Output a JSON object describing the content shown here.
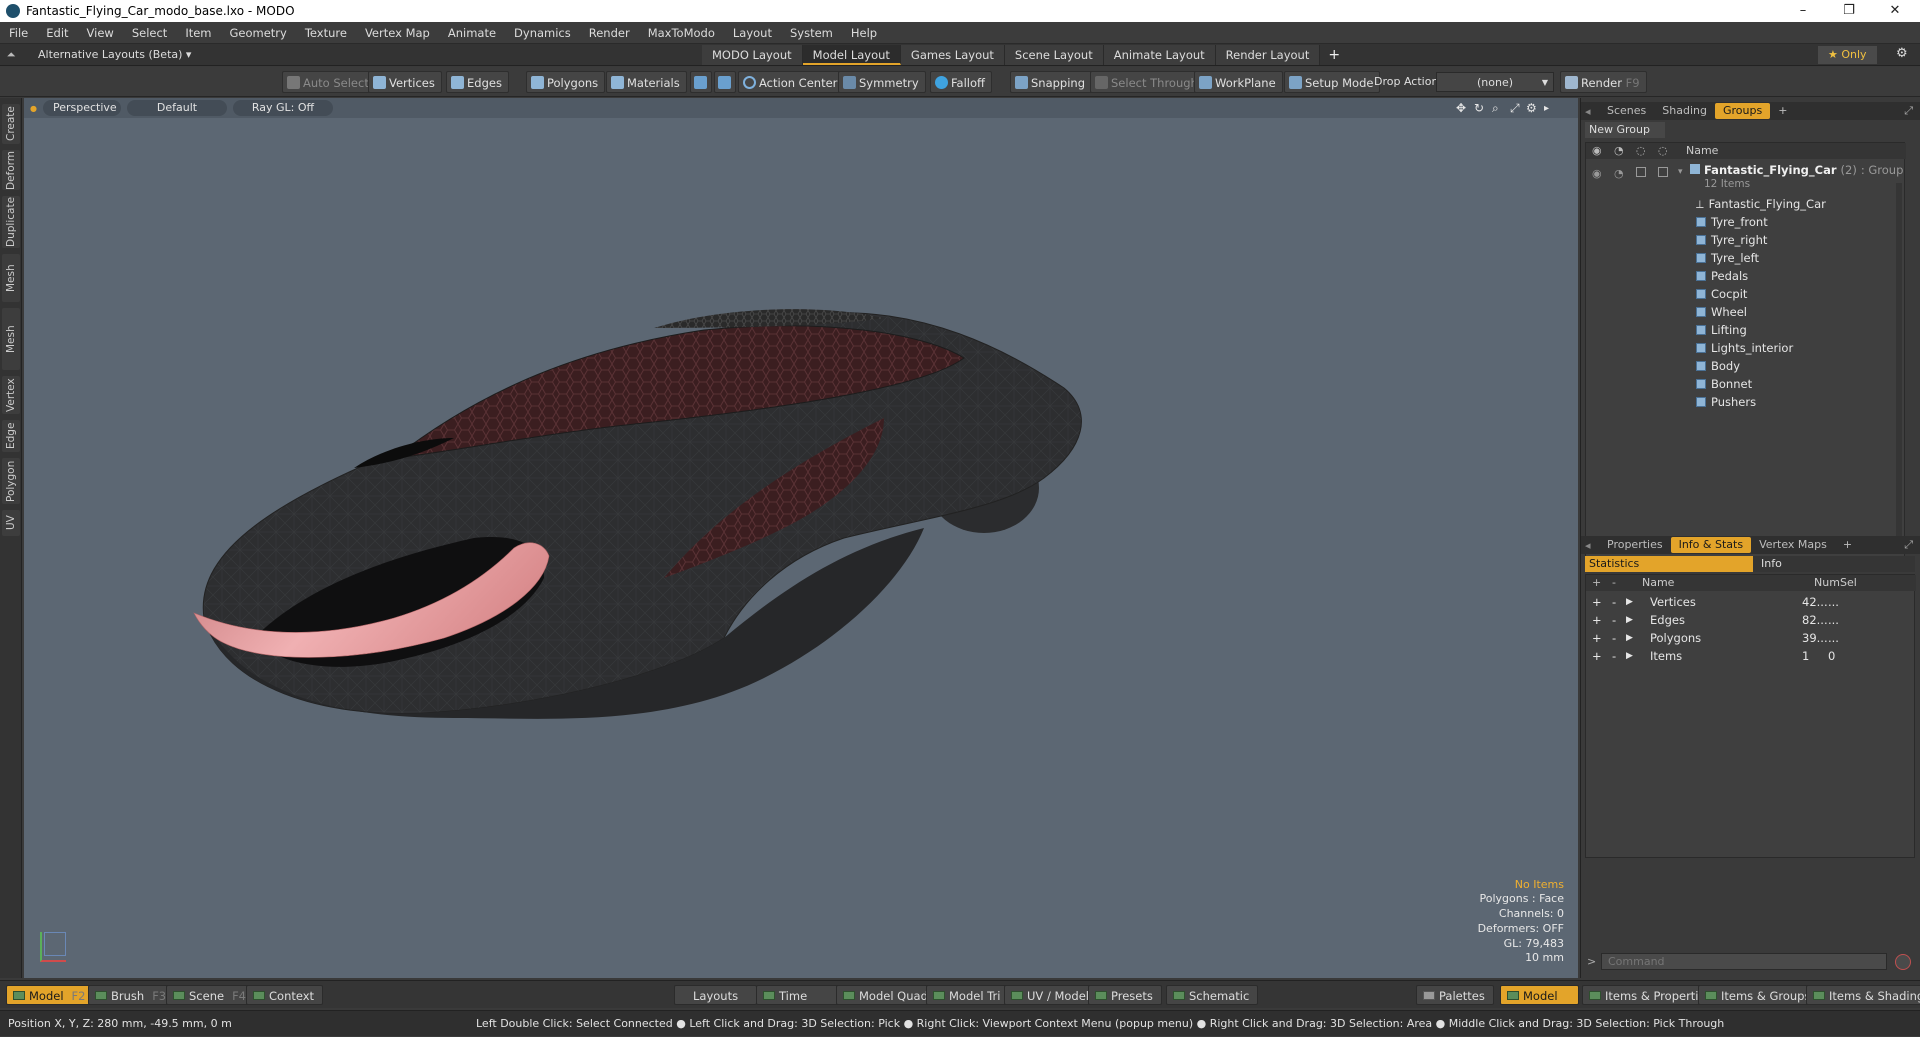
{
  "window": {
    "title": "Fantastic_Flying_Car_modo_base.lxo - MODO",
    "minimize": "–",
    "maximize": "❐",
    "close": "✕"
  },
  "menu": [
    "File",
    "Edit",
    "View",
    "Select",
    "Item",
    "Geometry",
    "Texture",
    "Vertex Map",
    "Animate",
    "Dynamics",
    "Render",
    "MaxToModo",
    "Layout",
    "System",
    "Help"
  ],
  "layouts": {
    "alt_label": "Alternative Layouts (Beta) ▾",
    "tabs": [
      "MODO Layout",
      "Model Layout",
      "Games Layout",
      "Scene Layout",
      "Animate Layout",
      "Render Layout"
    ],
    "active": "Model Layout",
    "add": "+",
    "only": "★  Only",
    "gear": "⚙"
  },
  "toolbar": {
    "auto_select": "Auto Select",
    "vertices": "Vertices",
    "edges": "Edges",
    "polygons": "Polygons",
    "materials": "Materials",
    "action_center": "Action Center",
    "symmetry": "Symmetry",
    "falloff": "Falloff",
    "snapping": "Snapping",
    "select_through": "Select Through",
    "workplane": "WorkPlane",
    "setup_mode": "Setup Mode",
    "drop_action": "Drop Action",
    "drop_value": "(none)",
    "render": "Render",
    "render_key": "F9"
  },
  "left_tabs": [
    "Create",
    "Deform",
    "Duplicate",
    "Mesh Edit",
    "Mesh Fusion",
    "Vertex",
    "Edge",
    "Polygon",
    "UV"
  ],
  "viewport": {
    "view": "Perspective",
    "shading": "Default",
    "raygl": "Ray GL: Off",
    "stats": [
      "No Items",
      "Polygons : Face",
      "Channels: 0",
      "Deformers: OFF",
      "GL: 79,483",
      "10 mm"
    ]
  },
  "scene_panel": {
    "tabs": [
      "Scenes",
      "Shading",
      "Groups"
    ],
    "active": "Groups",
    "new_group": "New Group",
    "name_header": "Name",
    "group_name": "Fantastic_Flying_Car",
    "group_count": "(2)",
    "group_type": ": Group",
    "group_items": "12 Items",
    "items": [
      "Fantastic_Flying_Car",
      "Tyre_front",
      "Tyre_right",
      "Tyre_left",
      "Pedals",
      "Cocpit",
      "Wheel",
      "Lifting",
      "Lights_interior",
      "Body",
      "Bonnet",
      "Pushers"
    ]
  },
  "info_panel": {
    "tabs": [
      "Properties",
      "Info & Stats",
      "Vertex Maps"
    ],
    "active": "Info & Stats",
    "subtabs": [
      "Statistics",
      "Info"
    ],
    "headers": {
      "name": "Name",
      "num": "Num",
      "sel": "Sel"
    },
    "rows": [
      {
        "name": "Vertices",
        "num": "42...",
        "sel": "..."
      },
      {
        "name": "Edges",
        "num": "82...",
        "sel": "..."
      },
      {
        "name": "Polygons",
        "num": "39...",
        "sel": "..."
      },
      {
        "name": "Items",
        "num": "1",
        "sel": "0"
      }
    ],
    "command_placeholder": "Command"
  },
  "bottom": {
    "model": "Model",
    "model_key": "F2",
    "brush": "Brush",
    "brush_key": "F3",
    "scene": "Scene",
    "scene_key": "F4",
    "context": "Context",
    "layouts": "Layouts",
    "time": "Time",
    "model_quad": "Model Quad",
    "model_tri": "Model Tri",
    "uv_model": "UV / Model",
    "presets": "Presets",
    "schematic": "Schematic",
    "palettes": "Palettes",
    "model_right": "Model",
    "items_props": "Items & Properties",
    "items_groups": "Items & Groups",
    "items_shading": "Items & Shading"
  },
  "status": {
    "position": "Position X, Y, Z:   280 mm, -49.5 mm, 0 m",
    "hints": "Left Double Click: Select Connected ● Left Click and Drag: 3D Selection: Pick ● Right Click: Viewport Context Menu (popup menu) ● Right Click and Drag: 3D Selection: Area ● Middle Click and Drag: 3D Selection: Pick Through"
  }
}
